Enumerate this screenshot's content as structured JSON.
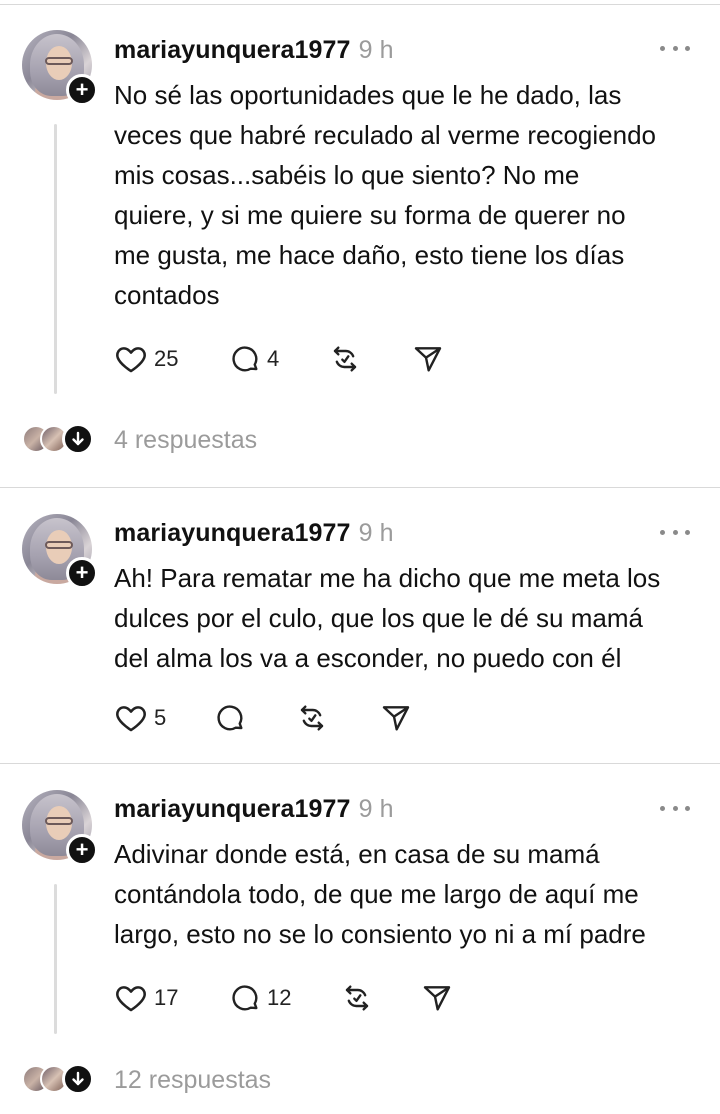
{
  "posts": [
    {
      "username": "mariayunquera1977",
      "time": "9 h",
      "text": "No sé las oportunidades que le he dado, las\nveces que habré reculado al verme recogiendo\nmis cosas...sabéis lo que siento? No me\nquiere, y si me quiere su forma de querer no\nme gusta, me hace daño, esto tiene los días\ncontados",
      "likes": "25",
      "comments": "4",
      "replies": "4 respuestas"
    },
    {
      "username": "mariayunquera1977",
      "time": "9 h",
      "text": "Ah! Para rematar me ha dicho que me meta los\ndulces por el culo, que los que le dé su mamá\ndel alma los va a esconder, no puedo con él",
      "likes": "5",
      "comments": ""
    },
    {
      "username": "mariayunquera1977",
      "time": "9 h",
      "text": "Adivinar donde está, en casa de su mamá\ncontándola todo, de que me largo de aquí me\nlargo, esto no se lo consiento yo ni a mí padre",
      "likes": "17",
      "comments": "12",
      "replies": "12 respuestas"
    }
  ],
  "icons": {
    "like": "heart-icon",
    "comment": "comment-bubble-icon",
    "repost": "repost-icon",
    "share": "send-icon",
    "more": "more-dots-icon",
    "follow": "plus-icon",
    "expand": "arrow-down-icon"
  }
}
